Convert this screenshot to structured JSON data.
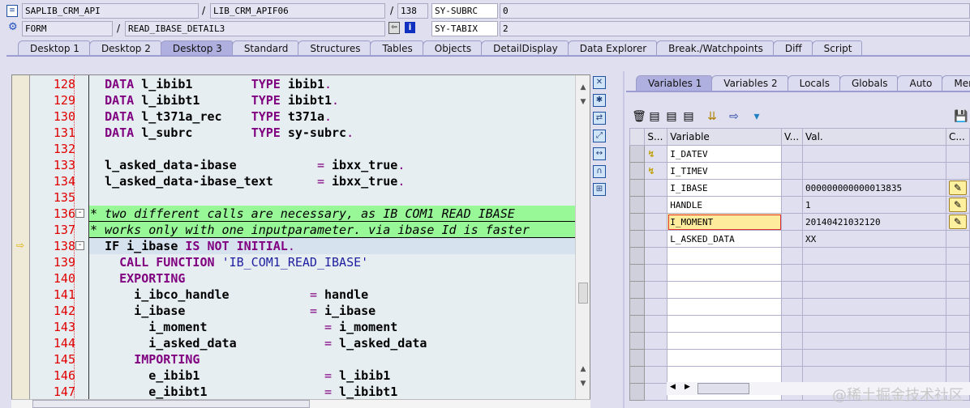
{
  "header": {
    "program": "SAPLIB_CRM_API",
    "include": "LIB_CRM_APIF06",
    "line": "138",
    "subrc_label": "SY-SUBRC",
    "subrc": "0",
    "event_type": "FORM",
    "event": "READ_IBASE_DETAIL3",
    "tabix_label": "SY-TABIX",
    "tabix": "2",
    "slash": "/"
  },
  "main_tabs": [
    "Desktop 1",
    "Desktop 2",
    "Desktop 3",
    "Standard",
    "Structures",
    "Tables",
    "Objects",
    "DetailDisplay",
    "Data Explorer",
    "Break./Watchpoints",
    "Diff",
    "Script"
  ],
  "active_main_tab": "Desktop 3",
  "code": [
    {
      "n": "128",
      "seg": [
        [
          "",
          "  "
        ],
        [
          "k",
          "DATA"
        ],
        [
          "i",
          " l_ibib1        "
        ],
        [
          "k",
          "TYPE"
        ],
        [
          "i",
          " ibib1"
        ],
        [
          "o",
          "."
        ]
      ]
    },
    {
      "n": "129",
      "seg": [
        [
          "",
          "  "
        ],
        [
          "k",
          "DATA"
        ],
        [
          "i",
          " l_ibibt1       "
        ],
        [
          "k",
          "TYPE"
        ],
        [
          "i",
          " ibibt1"
        ],
        [
          "o",
          "."
        ]
      ]
    },
    {
      "n": "130",
      "seg": [
        [
          "",
          "  "
        ],
        [
          "k",
          "DATA"
        ],
        [
          "i",
          " l_t371a_rec    "
        ],
        [
          "k",
          "TYPE"
        ],
        [
          "i",
          " t371a"
        ],
        [
          "o",
          "."
        ]
      ]
    },
    {
      "n": "131",
      "seg": [
        [
          "",
          "  "
        ],
        [
          "k",
          "DATA"
        ],
        [
          "i",
          " l_subrc        "
        ],
        [
          "k",
          "TYPE"
        ],
        [
          "i",
          " sy-subrc"
        ],
        [
          "o",
          "."
        ]
      ]
    },
    {
      "n": "132",
      "seg": []
    },
    {
      "n": "133",
      "seg": [
        [
          "i",
          "  l_asked_data-ibase           "
        ],
        [
          "o",
          "= "
        ],
        [
          "i",
          "ibxx_true"
        ],
        [
          "o",
          "."
        ]
      ]
    },
    {
      "n": "134",
      "seg": [
        [
          "i",
          "  l_asked_data-ibase_text      "
        ],
        [
          "o",
          "= "
        ],
        [
          "i",
          "ibxx_true"
        ],
        [
          "o",
          "."
        ]
      ]
    },
    {
      "n": "135",
      "seg": []
    },
    {
      "n": "136",
      "type": "comment",
      "fold": "-",
      "seg": [
        [
          "c",
          "* two different calls are necessary, as IB COM1 READ IBASE"
        ]
      ]
    },
    {
      "n": "137",
      "type": "comment",
      "seg": [
        [
          "c",
          "* works only with one inputparameter. via ibase Id is faster"
        ]
      ]
    },
    {
      "n": "138",
      "type": "current",
      "fold": "-",
      "seg": [
        [
          "",
          "  "
        ],
        [
          "i",
          "IF i_ibase "
        ],
        [
          "k",
          "IS NOT INITIAL"
        ],
        [
          "o",
          "."
        ]
      ]
    },
    {
      "n": "139",
      "seg": [
        [
          "",
          "    "
        ],
        [
          "k",
          "CALL FUNCTION "
        ],
        [
          "s",
          "'IB_COM1_READ_IBASE'"
        ]
      ]
    },
    {
      "n": "140",
      "seg": [
        [
          "",
          "    "
        ],
        [
          "k",
          "EXPORTING"
        ]
      ]
    },
    {
      "n": "141",
      "seg": [
        [
          "i",
          "      i_ibco_handle           "
        ],
        [
          "o",
          "= "
        ],
        [
          "i",
          "handle"
        ]
      ]
    },
    {
      "n": "142",
      "seg": [
        [
          "i",
          "      i_ibase                 "
        ],
        [
          "o",
          "= "
        ],
        [
          "i",
          "i_ibase"
        ]
      ]
    },
    {
      "n": "143",
      "seg": [
        [
          "i",
          "        i_moment                "
        ],
        [
          "o",
          "= "
        ],
        [
          "i",
          "i_moment"
        ]
      ]
    },
    {
      "n": "144",
      "seg": [
        [
          "i",
          "        i_asked_data            "
        ],
        [
          "o",
          "= "
        ],
        [
          "i",
          "l_asked_data"
        ]
      ]
    },
    {
      "n": "145",
      "seg": [
        [
          "",
          "      "
        ],
        [
          "k",
          "IMPORTING"
        ]
      ]
    },
    {
      "n": "146",
      "seg": [
        [
          "i",
          "        e_ibib1                 "
        ],
        [
          "o",
          "= "
        ],
        [
          "i",
          "l_ibib1"
        ]
      ]
    },
    {
      "n": "147",
      "seg": [
        [
          "i",
          "        e_ibibt1                "
        ],
        [
          "o",
          "= "
        ],
        [
          "i",
          "l_ibibt1"
        ]
      ]
    }
  ],
  "var_tabs": [
    "Variables 1",
    "Variables 2",
    "Locals",
    "Globals",
    "Auto",
    "Memory"
  ],
  "active_var_tab": "Variables 1",
  "grid": {
    "columns": [
      "S...",
      "Variable",
      "V...",
      "Val.",
      "C..."
    ],
    "rows": [
      {
        "icon": "import-param-icon",
        "variable": "I_DATEV",
        "value": "",
        "edit": false
      },
      {
        "icon": "import-param-icon",
        "variable": "I_TIMEV",
        "value": "",
        "edit": false
      },
      {
        "icon": "",
        "variable": "I_IBASE",
        "value": "000000000000013835",
        "edit": true
      },
      {
        "icon": "",
        "variable": "HANDLE",
        "value": "1",
        "edit": true
      },
      {
        "icon": "",
        "variable": "I_MOMENT",
        "value": "20140421032120",
        "edit": true,
        "selected": true
      },
      {
        "icon": "",
        "variable": "L_ASKED_DATA",
        "value": "XX",
        "edit": false
      }
    ],
    "empty_rows": 9
  },
  "watermark": "@稀土掘金技术社区",
  "colors": {
    "keyword": "#800080",
    "string": "#2020a0",
    "line_number": "#e00000",
    "comment_bg": "#98f898",
    "current_line": "#d6e2ee",
    "tab_active": "#b0b0e0"
  }
}
